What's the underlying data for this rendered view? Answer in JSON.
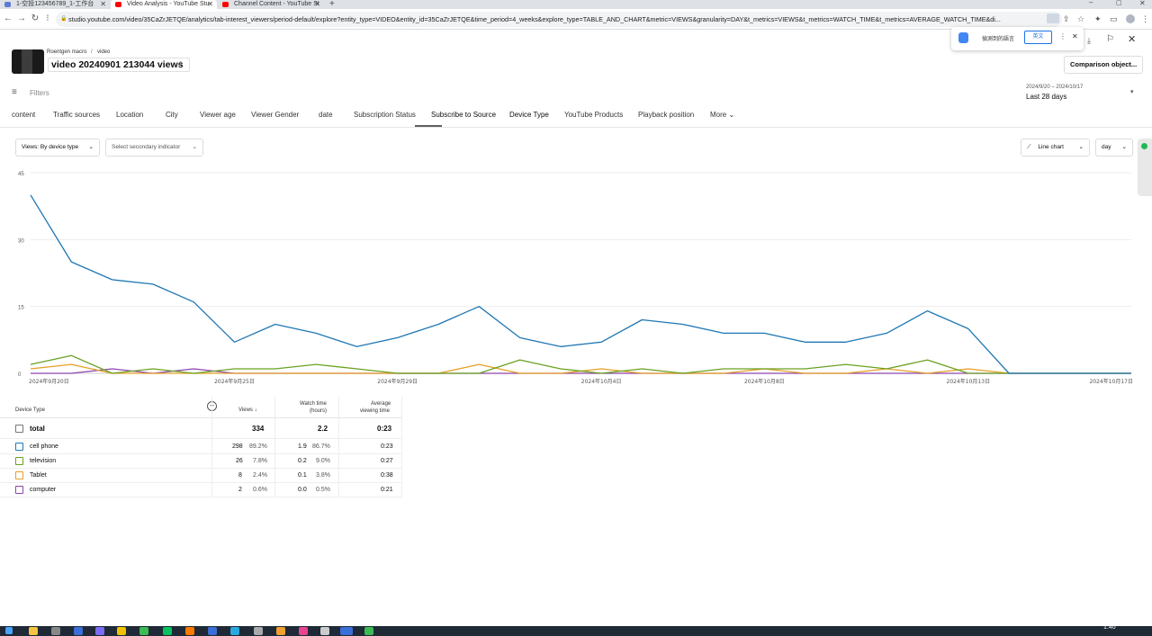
{
  "browser": {
    "tabs": [
      {
        "label": "1-空投123456789_1-工作台",
        "active": false
      },
      {
        "label": "Video Analysis - YouTube Stu",
        "active": true
      },
      {
        "label": "Channel Content - YouTube St",
        "active": false
      }
    ],
    "url": "studio.youtube.com/video/35CaZrJETQE/analytics/tab-interest_viewers/period-default/explore?entity_type=VIDEO&entity_id=35CaZrJETQE&time_period=4_weeks&explore_type=TABLE_AND_CHART&metric=VIEWS&granularity=DAY&t_metrics=VIEWS&t_metrics=WATCH_TIME&t_metrics=AVERAGE_WATCH_TIME&di..."
  },
  "translate_popup": {
    "prompt": "偵測到的語言",
    "option": "英文"
  },
  "header": {
    "breadcrumb_channel": "Roentgen macro",
    "breadcrumb_sep": "/",
    "breadcrumb_page": "video",
    "title": "video 20240901 213044 views",
    "compare_button": "Comparison object..."
  },
  "filters": {
    "label": "Filters"
  },
  "period": {
    "range": "2024/9/20 – 2024/10/17",
    "label": "Last 28 days"
  },
  "tabs": [
    {
      "label": "content"
    },
    {
      "label": "Traffic sources"
    },
    {
      "label": "Location"
    },
    {
      "label": "City"
    },
    {
      "label": "Viewer age"
    },
    {
      "label": "Viewer Gender"
    },
    {
      "label": "date"
    },
    {
      "label": "Subscription Status"
    },
    {
      "label": "Subscribe to Source"
    },
    {
      "label": "Device Type"
    },
    {
      "label": "YouTube Products"
    },
    {
      "label": "Playback position"
    },
    {
      "label": "More"
    }
  ],
  "controls": {
    "metric_select": "Views: By device type",
    "secondary_select": "Select secondary indicator",
    "chart_type": "Line chart",
    "granularity": "day"
  },
  "chart_data": {
    "type": "line",
    "x": [
      "2024/9/20",
      "2024/9/21",
      "2024/9/22",
      "2024/9/23",
      "2024/9/24",
      "2024/9/25",
      "2024/9/26",
      "2024/9/27",
      "2024/9/28",
      "2024/9/29",
      "2024/9/30",
      "2024/10/1",
      "2024/10/2",
      "2024/10/3",
      "2024/10/4",
      "2024/10/5",
      "2024/10/6",
      "2024/10/7",
      "2024/10/8",
      "2024/10/9",
      "2024/10/10",
      "2024/10/11",
      "2024/10/12",
      "2024/10/13",
      "2024/10/14",
      "2024/10/15",
      "2024/10/16",
      "2024/10/17"
    ],
    "x_tick_labels": [
      {
        "index": 0,
        "label": "2024年9月20日"
      },
      {
        "index": 5,
        "label": "2024年9月25日"
      },
      {
        "index": 9,
        "label": "2024年9月29日"
      },
      {
        "index": 14,
        "label": "2024年10月4日"
      },
      {
        "index": 18,
        "label": "2024年10月8日"
      },
      {
        "index": 23,
        "label": "2024年10月13日"
      },
      {
        "index": 27,
        "label": "2024年10月17日"
      }
    ],
    "y_ticks": [
      0,
      15,
      30,
      45
    ],
    "ylim": [
      0,
      45
    ],
    "grid": true,
    "series": [
      {
        "name": "cell phone",
        "color": "#1f77b4",
        "values": [
          40,
          25,
          21,
          20,
          16,
          7,
          11,
          9,
          6,
          8,
          11,
          15,
          8,
          6,
          7,
          12,
          11,
          9,
          9,
          7,
          7,
          9,
          14,
          10,
          0,
          0,
          0,
          0
        ]
      },
      {
        "name": "television",
        "color": "#6aa121",
        "values": [
          2,
          4,
          0,
          1,
          0,
          1,
          1,
          2,
          1,
          0,
          0,
          0,
          3,
          1,
          0,
          1,
          0,
          1,
          1,
          1,
          2,
          1,
          3,
          0,
          0,
          0,
          0,
          0
        ]
      },
      {
        "name": "Tablet",
        "color": "#e5a024",
        "values": [
          1,
          2,
          0,
          0,
          0,
          0,
          0,
          0,
          0,
          0,
          0,
          2,
          0,
          0,
          1,
          0,
          0,
          0,
          1,
          0,
          0,
          1,
          0,
          1,
          0,
          0,
          0,
          0
        ]
      },
      {
        "name": "computer",
        "color": "#8e44ad",
        "values": [
          0,
          0,
          1,
          0,
          1,
          0,
          0,
          0,
          0,
          0,
          0,
          0,
          0,
          0,
          0,
          0,
          0,
          0,
          0,
          0,
          0,
          0,
          0,
          0,
          0,
          0,
          0,
          0
        ]
      }
    ]
  },
  "table": {
    "headers": {
      "device_type": "Device Type",
      "views": "Views",
      "watch_time_1": "Watch time",
      "watch_time_2": "(hours)",
      "avg_1": "Average",
      "avg_2": "viewing time"
    },
    "total": {
      "label": "total",
      "views": "334",
      "watch_time": "2.2",
      "avg": "0:23"
    },
    "rows": [
      {
        "label": "cell phone",
        "color": "#1f77b4",
        "views": "298",
        "views_pct": "89.2%",
        "watch": "1.9",
        "watch_pct": "86.7%",
        "avg": "0:23"
      },
      {
        "label": "television",
        "color": "#6aa121",
        "views": "26",
        "views_pct": "7.8%",
        "watch": "0.2",
        "watch_pct": "9.0%",
        "avg": "0:27"
      },
      {
        "label": "Tablet",
        "color": "#e5a024",
        "views": "8",
        "views_pct": "2.4%",
        "watch": "0.1",
        "watch_pct": "3.8%",
        "avg": "0:38"
      },
      {
        "label": "computer",
        "color": "#8e44ad",
        "views": "2",
        "views_pct": "0.6%",
        "watch": "0.0",
        "watch_pct": "0.5%",
        "avg": "0:21"
      }
    ]
  },
  "taskbar": {
    "time": "1:40"
  }
}
